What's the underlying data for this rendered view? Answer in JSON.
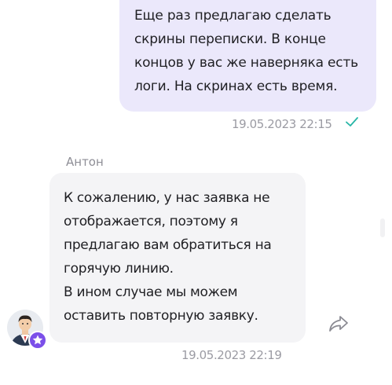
{
  "messages": {
    "outgoing": {
      "lines": [
        "Еще раз предлагаю сделать",
        "скрины переписки. В конце",
        "концов у вас же наверняка есть",
        "логи. На скринах есть время."
      ],
      "time": "19.05.2023 22:15",
      "status_icon": "check-icon"
    },
    "incoming": {
      "sender": "Антон",
      "lines": [
        "К сожалению, у нас заявка не",
        "отображается, поэтому я",
        "предлагаю вам обратиться на",
        "горячую линию.",
        "В ином случае мы можем",
        "оставить повторную заявку."
      ],
      "time": "19.05.2023 22:19",
      "avatar_icon": "operator-avatar",
      "badge_icon": "star-icon",
      "action_icon": "share-icon"
    }
  },
  "colors": {
    "outgoing_bubble": "#ebe8fb",
    "incoming_bubble": "#f4f4f6",
    "check": "#26b5a6",
    "badge": "#7b4fe9",
    "timestamp": "#9b9ba3"
  }
}
